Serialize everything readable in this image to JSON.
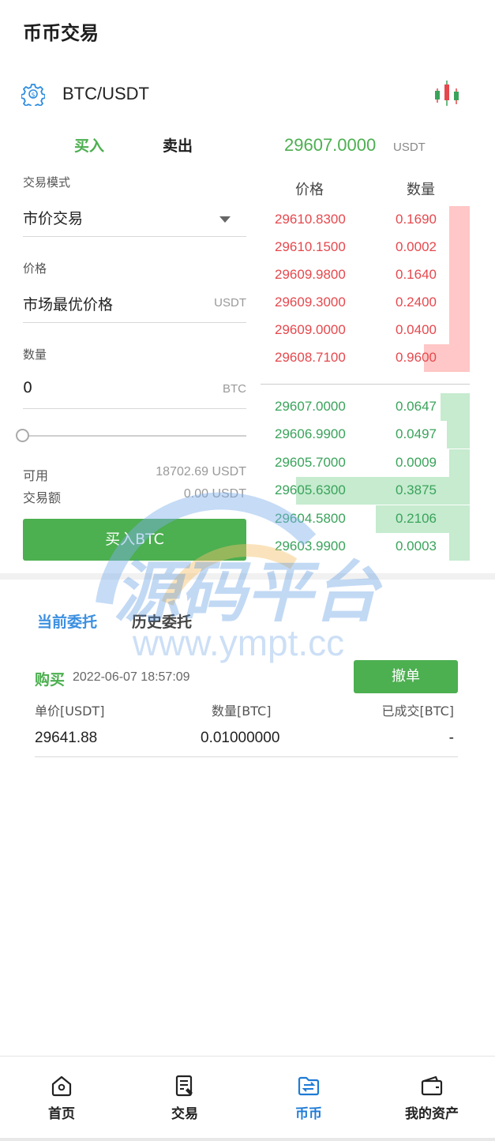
{
  "header": {
    "title": "币币交易"
  },
  "pair": {
    "name": "BTC/USDT"
  },
  "trade_tabs": {
    "buy": "买入",
    "sell": "卖出"
  },
  "ticker": {
    "price": "29607.0000",
    "unit": "USDT"
  },
  "form": {
    "mode_label": "交易模式",
    "mode_value": "市价交易",
    "price_label": "价格",
    "price_value": "市场最优价格",
    "price_unit": "USDT",
    "qty_label": "数量",
    "qty_value": "0",
    "qty_unit": "BTC",
    "slider_percent": 0,
    "available_label": "可用",
    "available_value": "18702.69 USDT",
    "amount_label": "交易额",
    "amount_value": "0.00 USDT",
    "submit_label": "买入BTC"
  },
  "orderbook": {
    "price_header": "价格",
    "qty_header": "数量",
    "asks": [
      {
        "price": "29610.8300",
        "qty": "0.1690",
        "depth": 0.1
      },
      {
        "price": "29610.1500",
        "qty": "0.0002",
        "depth": 0.1
      },
      {
        "price": "29609.9800",
        "qty": "0.1640",
        "depth": 0.1
      },
      {
        "price": "29609.3000",
        "qty": "0.2400",
        "depth": 0.1
      },
      {
        "price": "29609.0000",
        "qty": "0.0400",
        "depth": 0.1
      },
      {
        "price": "29608.7100",
        "qty": "0.9600",
        "depth": 0.22
      }
    ],
    "bids": [
      {
        "price": "29607.0000",
        "qty": "0.0647",
        "depth": 0.14
      },
      {
        "price": "29606.9900",
        "qty": "0.0497",
        "depth": 0.11
      },
      {
        "price": "29605.7000",
        "qty": "0.0009",
        "depth": 0.1
      },
      {
        "price": "29605.6300",
        "qty": "0.3875",
        "depth": 0.83
      },
      {
        "price": "29604.5800",
        "qty": "0.2106",
        "depth": 0.45
      },
      {
        "price": "29603.9900",
        "qty": "0.0003",
        "depth": 0.1
      }
    ]
  },
  "orders": {
    "current_tab": "当前委托",
    "history_tab": "历史委托",
    "items": [
      {
        "side": "购买",
        "time": "2022-06-07 18:57:09",
        "cancel_label": "撤单",
        "price_header": "单价[USDT]",
        "qty_header": "数量[BTC]",
        "filled_header": "已成交[BTC]",
        "price": "29641.88",
        "qty": "0.01000000",
        "filled": "-"
      }
    ]
  },
  "watermark": {
    "text": "源码平台",
    "url": "www.ympt.cc"
  },
  "tabbar": {
    "items": [
      {
        "label": "首页",
        "icon": "home-icon"
      },
      {
        "label": "交易",
        "icon": "trade-icon"
      },
      {
        "label": "币币",
        "icon": "exchange-icon"
      },
      {
        "label": "我的资产",
        "icon": "wallet-icon"
      }
    ],
    "active": 2
  },
  "colors": {
    "accent": "#4caf50",
    "ask": "#e5484d",
    "bid": "#3aa35b",
    "link": "#1e7bd6"
  }
}
